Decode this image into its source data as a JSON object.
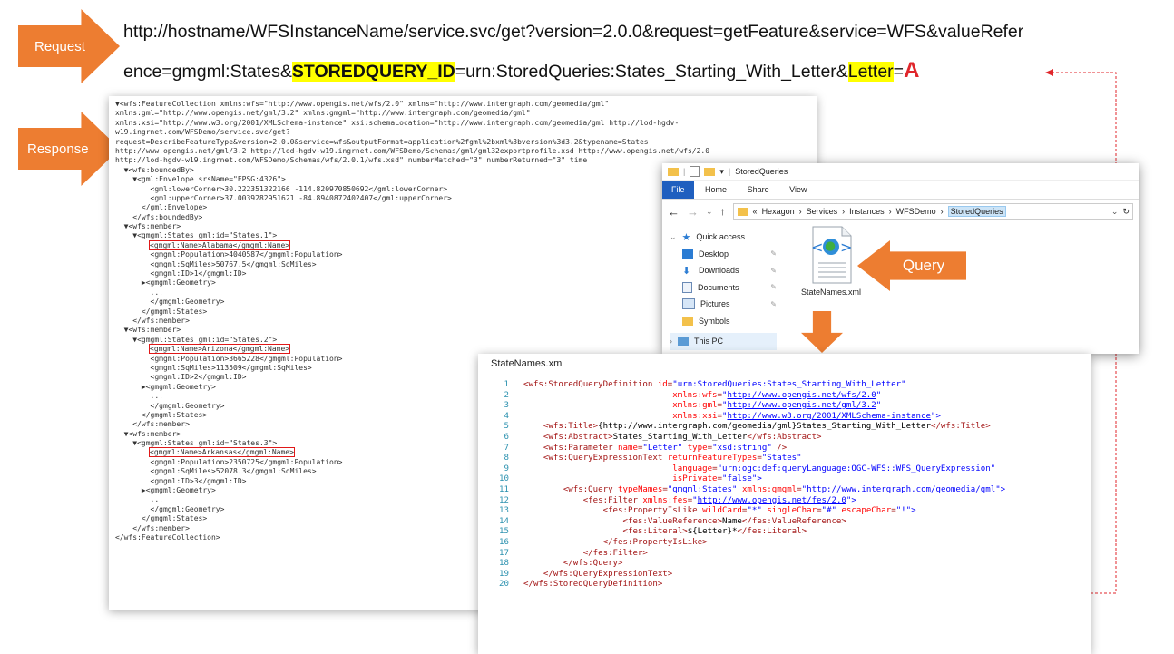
{
  "labels": {
    "request": "Request",
    "response": "Response",
    "query": "Query"
  },
  "colors": {
    "arrow": "#ed7d31",
    "highlight": "#ffff00",
    "letter_value": "#e0262b",
    "callout_box": "#e01818"
  },
  "request_url": {
    "line1": "http://hostname/WFSInstanceName/service.svc/get?version=2.0.0&request=getFeature&service=WFS&valueRefer",
    "line2_a": "ence=gmgml:States&",
    "line2_b": "STOREDQUERY_ID",
    "line2_c": "=urn:StoredQueries:States_Starting_With_Letter&",
    "line2_d": "Letter",
    "line2_e": "=",
    "line2_f": "A"
  },
  "response_xml": {
    "header": [
      "▼<wfs:FeatureCollection xmlns:wfs=\"http://www.opengis.net/wfs/2.0\" xmlns=\"http://www.intergraph.com/geomedia/gml\"",
      "xmlns:gml=\"http://www.opengis.net/gml/3.2\" xmlns:gmgml=\"http://www.intergraph.com/geomedia/gml\"",
      "xmlns:xsi=\"http://www.w3.org/2001/XMLSchema-instance\" xsi:schemaLocation=\"http://www.intergraph.com/geomedia/gml http://lod-hgdv-",
      "w19.ingrnet.com/WFSDemo/service.svc/get?",
      "request=DescribeFeatureType&version=2.0.0&service=wfs&outputFormat=application%2fgml%2bxml%3bversion%3d3.2&typename=States",
      "http://www.opengis.net/gml/3.2 http://lod-hgdv-w19.ingrnet.com/WFSDemo/Schemas/gml/gml32exportprofile.xsd http://www.opengis.net/wfs/2.0",
      "http://lod-hgdv-w19.ingrnet.com/WFSDemo/Schemas/wfs/2.0.1/wfs.xsd\" numberMatched=\"3\" numberReturned=\"3\" time"
    ],
    "bounded": [
      "  ▼<wfs:boundedBy>",
      "    ▼<gml:Envelope srsName=\"EPSG:4326\">",
      "        <gml:lowerCorner>30.222351322166 -114.820970850692</gml:lowerCorner>",
      "        <gml:upperCorner>37.0039282951621 -84.8940872402407</gml:upperCorner>",
      "      </gml:Envelope>",
      "    </wfs:boundedBy>"
    ],
    "members": [
      {
        "open": "  ▼<wfs:member>",
        "states_open": "    ▼<gmgml:States gml:id=\"States.1\">",
        "name_line": "<gmgml:Name>Alabama</gmgml:Name>",
        "rest": [
          "        <gmgml:Population>4040587</gmgml:Population>",
          "        <gmgml:SqMiles>50767.5</gmgml:SqMiles>",
          "        <gmgml:ID>1</gmgml:ID>",
          "      ▶<gmgml:Geometry>",
          "        ...",
          "        </gmgml:Geometry>",
          "      </gmgml:States>",
          "    </wfs:member>"
        ]
      },
      {
        "open": "  ▼<wfs:member>",
        "states_open": "    ▼<gmgml:States gml:id=\"States.2\">",
        "name_line": "<gmgml:Name>Arizona</gmgml:Name>",
        "rest": [
          "        <gmgml:Population>3665228</gmgml:Population>",
          "        <gmgml:SqMiles>113509</gmgml:SqMiles>",
          "        <gmgml:ID>2</gmgml:ID>",
          "      ▶<gmgml:Geometry>",
          "        ...",
          "        </gmgml:Geometry>",
          "      </gmgml:States>",
          "    </wfs:member>"
        ]
      },
      {
        "open": "  ▼<wfs:member>",
        "states_open": "    ▼<gmgml:States gml:id=\"States.3\">",
        "name_line": "<gmgml:Name>Arkansas</gmgml:Name>",
        "rest": [
          "        <gmgml:Population>2350725</gmgml:Population>",
          "        <gmgml:SqMiles>52078.3</gmgml:SqMiles>",
          "        <gmgml:ID>3</gmgml:ID>",
          "      ▶<gmgml:Geometry>",
          "        ...",
          "        </gmgml:Geometry>",
          "      </gmgml:States>",
          "    </wfs:member>"
        ]
      }
    ],
    "footer": "</wfs:FeatureCollection>"
  },
  "explorer": {
    "title": "StoredQueries",
    "tabs": [
      "File",
      "Home",
      "Share",
      "View"
    ],
    "breadcrumb": {
      "prefix": "«",
      "parts": [
        "Hexagon",
        "Services",
        "Instances",
        "WFSDemo"
      ],
      "current": "StoredQueries",
      "sep": "›"
    },
    "nav": {
      "quick_access": "Quick access",
      "items": [
        "Desktop",
        "Downloads",
        "Documents",
        "Pictures",
        "Symbols"
      ],
      "this_pc": "This PC"
    },
    "file": {
      "name": "StateNames.xml"
    }
  },
  "editor": {
    "title": "StateNames.xml",
    "line_numbers": [
      "1",
      "2",
      "3",
      "4",
      "5",
      "6",
      "7",
      "8",
      "9",
      "10",
      "11",
      "12",
      "13",
      "14",
      "15",
      "16",
      "17",
      "18",
      "19",
      "20"
    ],
    "lines": [
      [
        {
          "t": "k",
          "v": "<wfs:StoredQueryDefinition "
        },
        {
          "t": "a",
          "v": "id"
        },
        {
          "t": "k",
          "v": "="
        },
        {
          "t": "v",
          "v": "\"urn:StoredQueries:States_Starting_With_Letter\""
        }
      ],
      [
        {
          "t": "x",
          "v": "                              "
        },
        {
          "t": "a",
          "v": "xmlns:wfs"
        },
        {
          "t": "k",
          "v": "="
        },
        {
          "t": "v",
          "v": "\""
        },
        {
          "t": "u",
          "v": "http://www.opengis.net/wfs/2.0"
        },
        {
          "t": "v",
          "v": "\""
        }
      ],
      [
        {
          "t": "x",
          "v": "                              "
        },
        {
          "t": "a",
          "v": "xmlns:gml"
        },
        {
          "t": "k",
          "v": "="
        },
        {
          "t": "v",
          "v": "\""
        },
        {
          "t": "u",
          "v": "http://www.opengis.net/gml/3.2"
        },
        {
          "t": "v",
          "v": "\""
        }
      ],
      [
        {
          "t": "x",
          "v": "                              "
        },
        {
          "t": "a",
          "v": "xmlns:xsi"
        },
        {
          "t": "k",
          "v": "="
        },
        {
          "t": "v",
          "v": "\""
        },
        {
          "t": "u",
          "v": "http://www.w3.org/2001/XMLSchema-instance"
        },
        {
          "t": "v",
          "v": "\">"
        }
      ],
      [
        {
          "t": "x",
          "v": "    "
        },
        {
          "t": "k",
          "v": "<wfs:Title>"
        },
        {
          "t": "et",
          "v": "{http://www.intergraph.com/geomedia/gml}States_Starting_With_Letter"
        },
        {
          "t": "k",
          "v": "</wfs:Title>"
        }
      ],
      [
        {
          "t": "x",
          "v": "    "
        },
        {
          "t": "k",
          "v": "<wfs:Abstract>"
        },
        {
          "t": "et",
          "v": "States_Starting_With_Letter"
        },
        {
          "t": "k",
          "v": "</wfs:Abstract>"
        }
      ],
      [
        {
          "t": "x",
          "v": "    "
        },
        {
          "t": "k",
          "v": "<wfs:Parameter "
        },
        {
          "t": "a",
          "v": "name"
        },
        {
          "t": "k",
          "v": "="
        },
        {
          "t": "v",
          "v": "\"Letter\" "
        },
        {
          "t": "a",
          "v": "type"
        },
        {
          "t": "k",
          "v": "="
        },
        {
          "t": "v",
          "v": "\"xsd:string\""
        },
        {
          "t": "k",
          "v": " />"
        }
      ],
      [
        {
          "t": "x",
          "v": "    "
        },
        {
          "t": "k",
          "v": "<wfs:QueryExpressionText "
        },
        {
          "t": "a",
          "v": "returnFeatureTypes"
        },
        {
          "t": "k",
          "v": "="
        },
        {
          "t": "v",
          "v": "\"States\""
        }
      ],
      [
        {
          "t": "x",
          "v": "                              "
        },
        {
          "t": "a",
          "v": "language"
        },
        {
          "t": "k",
          "v": "="
        },
        {
          "t": "v",
          "v": "\"urn:ogc:def:queryLanguage:OGC-WFS::WFS_QueryExpression\""
        }
      ],
      [
        {
          "t": "x",
          "v": "                              "
        },
        {
          "t": "a",
          "v": "isPrivate"
        },
        {
          "t": "k",
          "v": "="
        },
        {
          "t": "v",
          "v": "\"false\">"
        }
      ],
      [
        {
          "t": "x",
          "v": "        "
        },
        {
          "t": "k",
          "v": "<wfs:Query "
        },
        {
          "t": "a",
          "v": "typeNames"
        },
        {
          "t": "k",
          "v": "="
        },
        {
          "t": "v",
          "v": "\"gmgml:States\" "
        },
        {
          "t": "a",
          "v": "xmlns:gmgml"
        },
        {
          "t": "k",
          "v": "="
        },
        {
          "t": "v",
          "v": "\""
        },
        {
          "t": "u",
          "v": "http://www.intergraph.com/geomedia/gml"
        },
        {
          "t": "v",
          "v": "\">"
        }
      ],
      [
        {
          "t": "x",
          "v": "            "
        },
        {
          "t": "k",
          "v": "<fes:Filter "
        },
        {
          "t": "a",
          "v": "xmlns:fes"
        },
        {
          "t": "k",
          "v": "="
        },
        {
          "t": "v",
          "v": "\""
        },
        {
          "t": "u",
          "v": "http://www.opengis.net/fes/2.0"
        },
        {
          "t": "v",
          "v": "\">"
        }
      ],
      [
        {
          "t": "x",
          "v": "                "
        },
        {
          "t": "k",
          "v": "<fes:PropertyIsLike "
        },
        {
          "t": "a",
          "v": "wildCard"
        },
        {
          "t": "k",
          "v": "="
        },
        {
          "t": "v",
          "v": "\"*\" "
        },
        {
          "t": "a",
          "v": "singleChar"
        },
        {
          "t": "k",
          "v": "="
        },
        {
          "t": "v",
          "v": "\"#\" "
        },
        {
          "t": "a",
          "v": "escapeChar"
        },
        {
          "t": "k",
          "v": "="
        },
        {
          "t": "v",
          "v": "\"!\">"
        }
      ],
      [
        {
          "t": "x",
          "v": "                    "
        },
        {
          "t": "k",
          "v": "<fes:ValueReference>"
        },
        {
          "t": "et",
          "v": "Name"
        },
        {
          "t": "k",
          "v": "</fes:ValueReference>"
        }
      ],
      [
        {
          "t": "x",
          "v": "                    "
        },
        {
          "t": "k",
          "v": "<fes:Literal>"
        },
        {
          "t": "et",
          "v": "${Letter}*"
        },
        {
          "t": "k",
          "v": "</fes:Literal>"
        }
      ],
      [
        {
          "t": "x",
          "v": "                "
        },
        {
          "t": "k",
          "v": "</fes:PropertyIsLike>"
        }
      ],
      [
        {
          "t": "x",
          "v": "            "
        },
        {
          "t": "k",
          "v": "</fes:Filter>"
        }
      ],
      [
        {
          "t": "x",
          "v": "        "
        },
        {
          "t": "k",
          "v": "</wfs:Query>"
        }
      ],
      [
        {
          "t": "x",
          "v": "    "
        },
        {
          "t": "k",
          "v": "</wfs:QueryExpressionText>"
        }
      ],
      [
        {
          "t": "k",
          "v": "</wfs:StoredQueryDefinition>"
        }
      ]
    ]
  }
}
